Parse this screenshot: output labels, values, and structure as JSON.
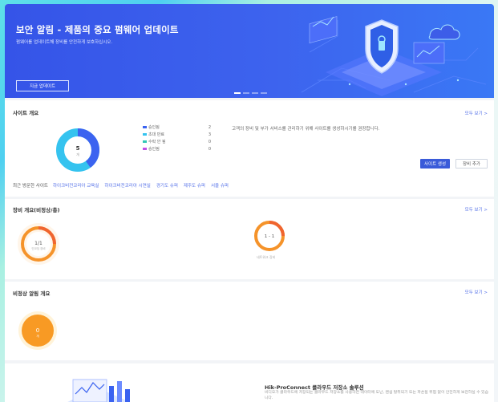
{
  "banner": {
    "title": "보안 알림 - 제품의 중요 펌웨어 업데이트",
    "description": "펌웨어를 업데이트해 장비를 안전하게 보호하십시오.",
    "button_label": "지금 업데이트",
    "slides_total": 4,
    "active_slide": 1
  },
  "site_overview": {
    "title": "사이트 개요",
    "view_all": "모두 보기 >",
    "total": "5",
    "total_caption": "개",
    "legend": [
      {
        "label": "승인됨",
        "count": "2",
        "color": "#3b63f0"
      },
      {
        "label": "초대 만료",
        "count": "3",
        "color": "#35c3ef"
      },
      {
        "label": "수락 안 됨",
        "count": "0",
        "color": "#31c7b5"
      },
      {
        "label": "승인됨",
        "count": "0",
        "color": "#c04ee8"
      }
    ],
    "description": "고객의 장비 및 부가 서비스를 관리하기 위해 사이트를 생성하시기를 권장합니다.",
    "create_button": "사이트 생성",
    "add_device_button": "장비 추가",
    "recent_label": "최근 방문한 사이트",
    "recent_sites": [
      "하이크비전코리아 교육실",
      "하이크비전코리아 시연실",
      "경기도 슈퍼",
      "제주도 슈퍼",
      "서울 슈퍼"
    ]
  },
  "device_overview": {
    "title": "장비 개요(비정상/총)",
    "view_all": "모두 보기 >",
    "device_value": "1/1",
    "device_caption": "인코딩 장비",
    "network_value": "1 - 1",
    "network_caption": "네트워크 장비"
  },
  "alarm_overview": {
    "title": "비정상 알림 개요",
    "view_all": "모두 보기 >",
    "value": "0",
    "caption": "개"
  },
  "promo": {
    "title": "Hik-ProConnect 클라우드 저장소 솔루션",
    "description": "비디오가 클라우드에 저장되는 클라우드 저장소를 사용하면 데이터에 도난, 랜섬 탈취되기 또는 파손될 위험 없이 안전하게 보관하실 수 있습니다."
  },
  "colors": {
    "accent": "#3a5bd9",
    "link": "#5470e8",
    "banner": "#3554e8",
    "warning": "#f5932a",
    "alert": "#f0652f"
  }
}
